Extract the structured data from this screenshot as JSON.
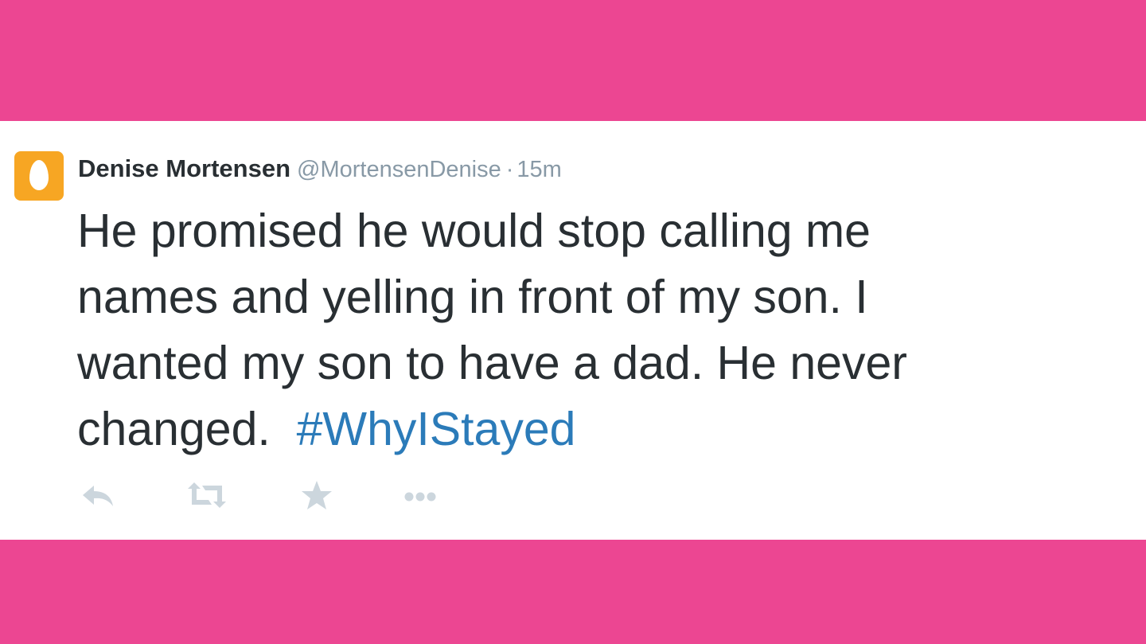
{
  "colors": {
    "background": "#ec4692",
    "card": "#ffffff",
    "avatar": "#f7a623",
    "name": "#292f33",
    "meta": "#8899a6",
    "hashtag": "#2b7bb9",
    "action_icons": "#ccd6dd"
  },
  "tweet": {
    "author_name": "Denise Mortensen",
    "handle": "@MortensenDenise",
    "separator": "·",
    "time": "15m",
    "text_line_1": "He promised he would stop calling me",
    "text_line_2": "names and yelling in front of my son.  I",
    "text_line_3": "wanted my son to have a dad.  He never",
    "text_line_4": "changed.  ",
    "hashtag": "#WhyIStayed"
  },
  "actions": [
    {
      "icon": "reply-icon"
    },
    {
      "icon": "retweet-icon"
    },
    {
      "icon": "favorite-star-icon"
    },
    {
      "icon": "more-dots-icon"
    }
  ]
}
